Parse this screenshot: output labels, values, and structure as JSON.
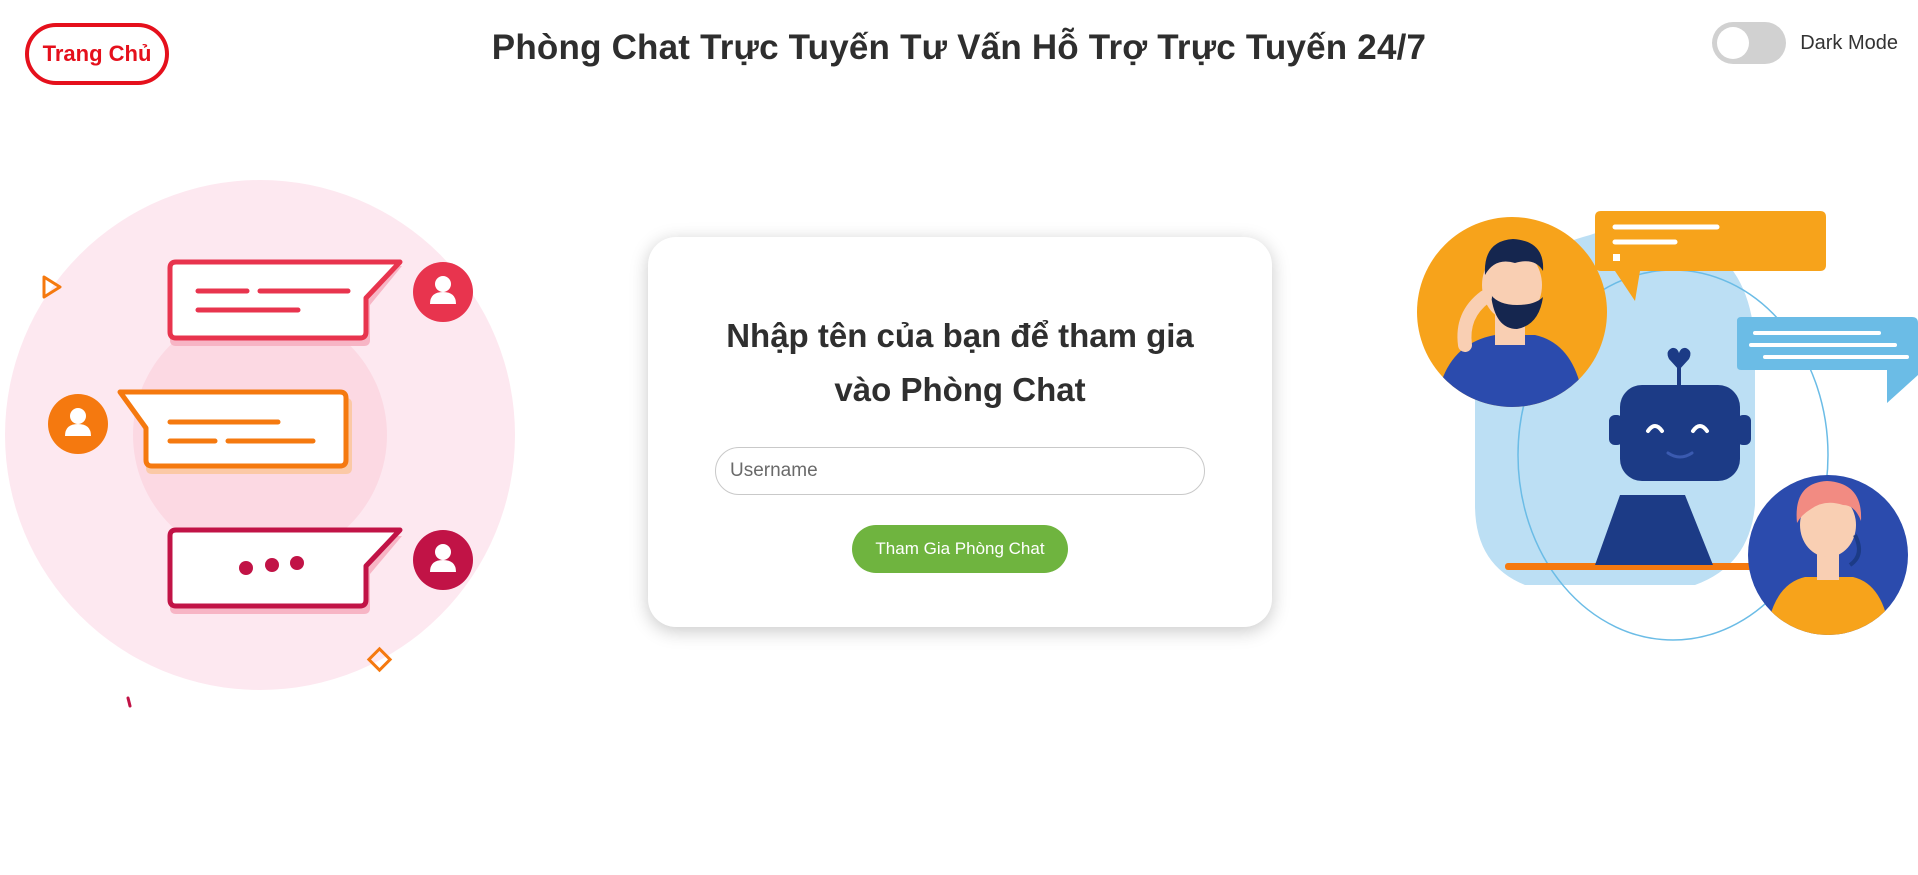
{
  "header": {
    "home_label": "Trang Chủ",
    "title": "Phòng Chat Trực Tuyến Tư Vấn Hỗ Trợ Trực Tuyến 24/7",
    "dark_mode_label": "Dark Mode",
    "dark_mode_on": false
  },
  "join_card": {
    "heading": "Nhập tên của bạn để tham gia vào Phòng Chat",
    "username_placeholder": "Username",
    "username_value": "",
    "join_button_label": "Tham Gia Phòng Chat"
  },
  "illustrations": {
    "left": "chat-bubbles-illustration",
    "right": "support-agents-robot-illustration"
  },
  "colors": {
    "home_red": "#e5101c",
    "join_green": "#6fb43f",
    "toggle_off": "#d1d1d1",
    "chat_red": "#e8344e",
    "chat_orange": "#f5790f",
    "chat_crimson": "#c11346",
    "pink_bg": "#fde8f0",
    "support_yellow": "#f7a31b",
    "support_blue": "#6bbce6",
    "robot_navy": "#1c3b86"
  }
}
